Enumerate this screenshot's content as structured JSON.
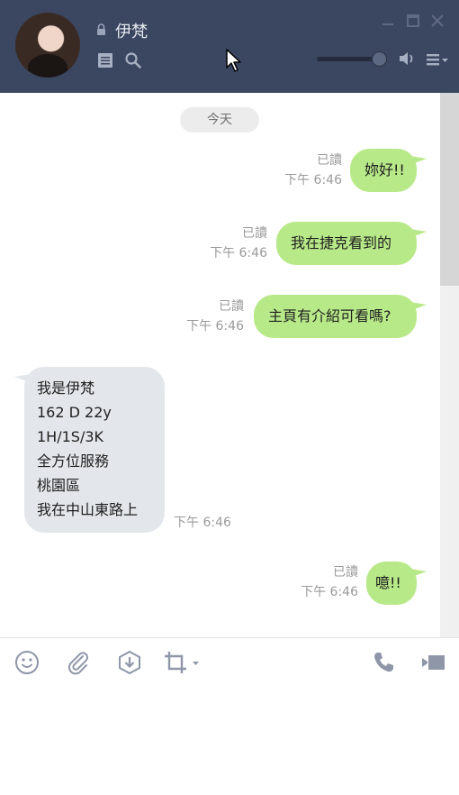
{
  "header": {
    "contact_name": "伊梵",
    "icons": [
      "lock-icon",
      "notes-icon",
      "search-icon",
      "minimize-icon",
      "maximize-icon",
      "close-icon",
      "speaker-icon",
      "menu-icon"
    ]
  },
  "chat": {
    "date_divider": "今天",
    "messages": [
      {
        "direction": "out",
        "text": "妳好!!",
        "status": "已讀",
        "time": "下午 6:46"
      },
      {
        "direction": "out",
        "text": "我在捷克看到的",
        "status": "已讀",
        "time": "下午 6:46"
      },
      {
        "direction": "out",
        "text": "主頁有介紹可看嗎?",
        "status": "已讀",
        "time": "下午 6:46"
      },
      {
        "direction": "in",
        "lines": [
          "我是伊梵",
          "162 D 22y",
          "1H/1S/3K",
          "全方位服務",
          "桃園區",
          "我在中山東路上"
        ],
        "time": "下午 6:46"
      },
      {
        "direction": "out",
        "text": "噫!!",
        "status": "已讀",
        "time": "下午 6:46"
      }
    ]
  },
  "toolbar": {
    "icons": [
      "emoji-icon",
      "attach-icon",
      "keep-icon",
      "screenshot-icon",
      "call-icon",
      "video-icon"
    ]
  },
  "colors": {
    "header_bg": "#3b4660",
    "outgoing_bubble": "#b8e989",
    "incoming_bubble": "#e3e7eb"
  }
}
